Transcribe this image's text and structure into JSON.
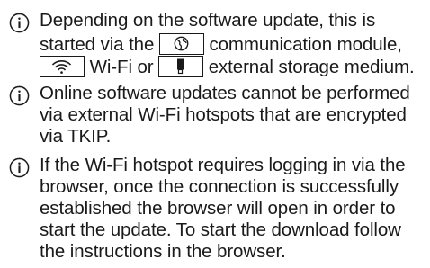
{
  "notes": [
    {
      "icon": "info-icon",
      "lines": [
        [
          "Depending on the software update, this is"
        ],
        [
          "started via the ",
          "",
          " communication module,"
        ],
        [
          "",
          " Wi-Fi or ",
          "",
          " external storage medium."
        ]
      ],
      "inline_icons": [
        "globe-icon",
        "wifi-icon",
        "usb-stick-icon"
      ]
    },
    {
      "icon": "info-icon",
      "lines": [
        [
          "Online software updates cannot be performed"
        ],
        [
          "via external Wi-Fi hotspots that are encrypted"
        ],
        [
          "via TKIP."
        ]
      ]
    },
    {
      "icon": "info-icon",
      "lines": [
        [
          "If the Wi-Fi hotspot requires logging in via the"
        ],
        [
          "browser, once the connection is successfully"
        ],
        [
          "established the browser will open in order to"
        ],
        [
          "start the update. To start the download follow"
        ],
        [
          "the instructions in the browser."
        ]
      ]
    }
  ]
}
